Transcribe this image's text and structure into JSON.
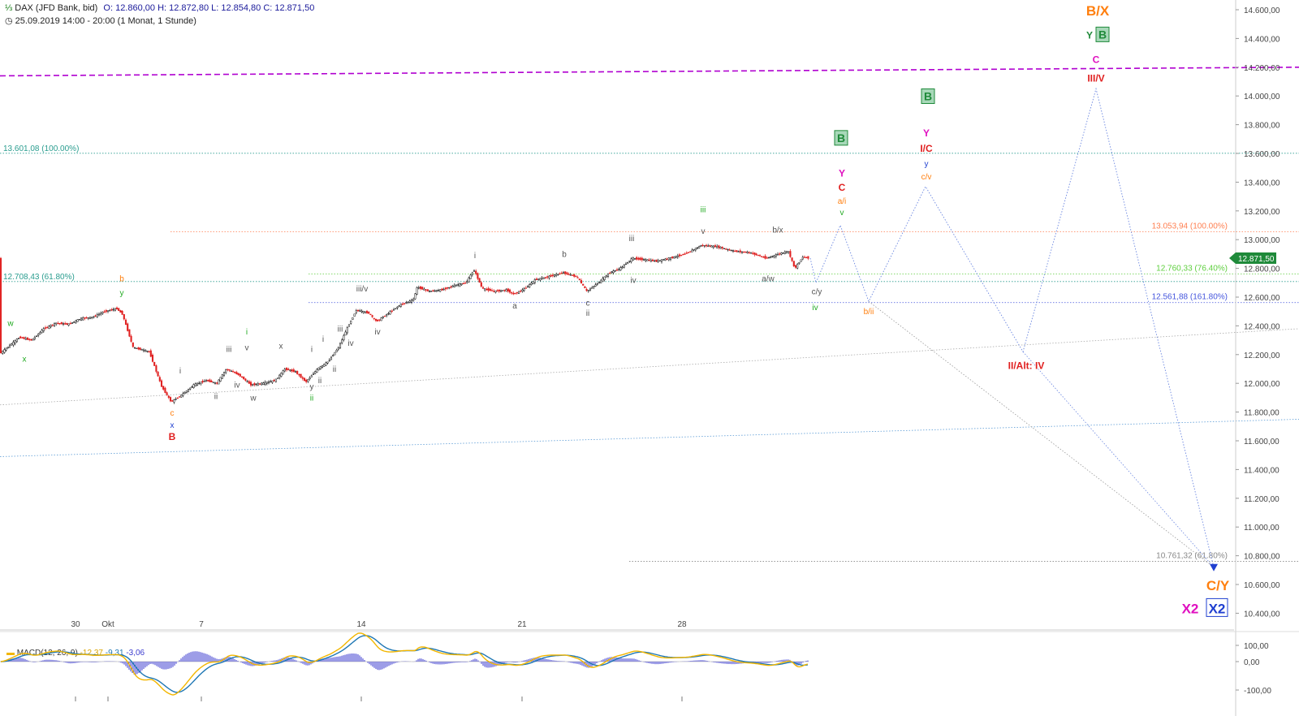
{
  "header": {
    "instrument": "DAX (JFD Bank, bid)",
    "ohlc": "O: 12.860,00  H: 12.872,80  L: 12.854,80  C: 12.871,50",
    "period": "25.09.2019 14:00 - 20:00   (1 Monat, 1 Stunde)"
  },
  "macd": {
    "label": "MACD(12, 26, 9)",
    "v1": "-12,37",
    "v2": "-9,31",
    "v3": "-3,06",
    "axis_labels": [
      "100,00",
      "0,00",
      "-100,00"
    ]
  },
  "price_badge": "12.871,50",
  "colors": {
    "candle_up": "#111111",
    "candle_down": "#e02020",
    "macd_line": "#f2b600",
    "signal_line": "#1f77b4",
    "hist": "#3b3bcf",
    "projection": "#6a86e0",
    "dashed_resistance": "#b000d0",
    "badge": "#1f8a3a"
  },
  "chart_data": {
    "type": "line",
    "title": "",
    "ylabel": "",
    "y_axis_ticks": [
      "14.600,00",
      "14.400,00",
      "14.200,00",
      "14.000,00",
      "13.800,00",
      "13.600,00",
      "13.400,00",
      "13.200,00",
      "13.000,00",
      "12.800,00",
      "12.600,00",
      "12.400,00",
      "12.200,00",
      "12.000,00",
      "11.800,00",
      "11.600,00",
      "11.400,00",
      "11.200,00",
      "11.000,00",
      "10.800,00",
      "10.600,00",
      "10.400,00"
    ],
    "ylim": [
      10350,
      14650
    ],
    "x_axis_labels": [
      "30",
      "Okt",
      "7",
      "14",
      "21",
      "28"
    ],
    "price_path": [
      {
        "x": 0,
        "y": 12200
      },
      {
        "x": 10,
        "y": 12250
      },
      {
        "x": 25,
        "y": 12320
      },
      {
        "x": 40,
        "y": 12300
      },
      {
        "x": 55,
        "y": 12380
      },
      {
        "x": 70,
        "y": 12420
      },
      {
        "x": 85,
        "y": 12410
      },
      {
        "x": 100,
        "y": 12450
      },
      {
        "x": 115,
        "y": 12460
      },
      {
        "x": 130,
        "y": 12500
      },
      {
        "x": 145,
        "y": 12520
      },
      {
        "x": 152,
        "y": 12480
      },
      {
        "x": 165,
        "y": 12250
      },
      {
        "x": 185,
        "y": 12220
      },
      {
        "x": 200,
        "y": 11980
      },
      {
        "x": 212,
        "y": 11870
      },
      {
        "x": 225,
        "y": 11920
      },
      {
        "x": 240,
        "y": 11990
      },
      {
        "x": 255,
        "y": 12020
      },
      {
        "x": 268,
        "y": 12000
      },
      {
        "x": 280,
        "y": 12100
      },
      {
        "x": 295,
        "y": 12060
      },
      {
        "x": 310,
        "y": 11990
      },
      {
        "x": 325,
        "y": 12000
      },
      {
        "x": 340,
        "y": 12020
      },
      {
        "x": 352,
        "y": 12100
      },
      {
        "x": 365,
        "y": 12080
      },
      {
        "x": 378,
        "y": 12010
      },
      {
        "x": 392,
        "y": 12100
      },
      {
        "x": 405,
        "y": 12150
      },
      {
        "x": 418,
        "y": 12250
      },
      {
        "x": 430,
        "y": 12400
      },
      {
        "x": 440,
        "y": 12510
      },
      {
        "x": 455,
        "y": 12490
      },
      {
        "x": 465,
        "y": 12430
      },
      {
        "x": 480,
        "y": 12490
      },
      {
        "x": 495,
        "y": 12550
      },
      {
        "x": 510,
        "y": 12580
      },
      {
        "x": 515,
        "y": 12670
      },
      {
        "x": 530,
        "y": 12640
      },
      {
        "x": 545,
        "y": 12650
      },
      {
        "x": 560,
        "y": 12680
      },
      {
        "x": 575,
        "y": 12700
      },
      {
        "x": 585,
        "y": 12790
      },
      {
        "x": 595,
        "y": 12660
      },
      {
        "x": 610,
        "y": 12640
      },
      {
        "x": 625,
        "y": 12650
      },
      {
        "x": 634,
        "y": 12620
      },
      {
        "x": 648,
        "y": 12660
      },
      {
        "x": 660,
        "y": 12720
      },
      {
        "x": 675,
        "y": 12740
      },
      {
        "x": 695,
        "y": 12770
      },
      {
        "x": 712,
        "y": 12740
      },
      {
        "x": 724,
        "y": 12640
      },
      {
        "x": 738,
        "y": 12700
      },
      {
        "x": 752,
        "y": 12770
      },
      {
        "x": 765,
        "y": 12800
      },
      {
        "x": 780,
        "y": 12870
      },
      {
        "x": 795,
        "y": 12860
      },
      {
        "x": 810,
        "y": 12850
      },
      {
        "x": 825,
        "y": 12870
      },
      {
        "x": 845,
        "y": 12900
      },
      {
        "x": 865,
        "y": 12960
      },
      {
        "x": 885,
        "y": 12950
      },
      {
        "x": 905,
        "y": 12920
      },
      {
        "x": 925,
        "y": 12910
      },
      {
        "x": 945,
        "y": 12870
      },
      {
        "x": 960,
        "y": 12900
      },
      {
        "x": 972,
        "y": 12920
      },
      {
        "x": 980,
        "y": 12800
      },
      {
        "x": 990,
        "y": 12880
      },
      {
        "x": 998,
        "y": 12871
      }
    ],
    "projection_paths": [
      [
        {
          "x": 998,
          "y": 12871
        },
        {
          "x": 1005,
          "y": 12700
        },
        {
          "x": 1035,
          "y": 13100
        },
        {
          "x": 1070,
          "y": 12570
        },
        {
          "x": 1140,
          "y": 13370
        },
        {
          "x": 1260,
          "y": 12220
        },
        {
          "x": 1350,
          "y": 14050
        },
        {
          "x": 1495,
          "y": 10720
        }
      ]
    ],
    "fib_levels": [
      {
        "value": 13601.08,
        "label": "13.601,08 (100.00%)"
      },
      {
        "value": 12708.43,
        "label": "12.708,43 (61.80%)"
      },
      {
        "value": 13053.94,
        "label": "13.053,94 (100.00%)"
      },
      {
        "value": 12760.33,
        "label": "12.760,33 (76.40%)"
      },
      {
        "value": 12561.88,
        "label": "12.561,88 (161.80%)"
      },
      {
        "value": 10761.32,
        "label": "10.761,32 (61.80%)"
      }
    ],
    "wave_labels": [
      {
        "text": "w",
        "x": 13,
        "y": 12400,
        "color": "#22aa22"
      },
      {
        "text": "x",
        "x": 30,
        "y": 12150,
        "color": "#22aa22"
      },
      {
        "text": "b",
        "x": 150,
        "y": 12710,
        "color": "#ff7f0e"
      },
      {
        "text": "y",
        "x": 150,
        "y": 12610,
        "color": "#22aa22"
      },
      {
        "text": "c",
        "x": 212,
        "y": 11775,
        "color": "#ff7f0e"
      },
      {
        "text": "x",
        "x": 212,
        "y": 11690,
        "color": "#1f3fd0"
      },
      {
        "text": "B",
        "x": 212,
        "y": 11605,
        "color": "#e02020"
      },
      {
        "text": "i",
        "x": 222,
        "y": 12070,
        "color": "#555555"
      },
      {
        "text": "ii",
        "x": 266,
        "y": 11890,
        "color": "#555555"
      },
      {
        "text": "iii",
        "x": 282,
        "y": 12220,
        "color": "#555555"
      },
      {
        "text": "iv",
        "x": 292,
        "y": 11970,
        "color": "#555555"
      },
      {
        "text": "v",
        "x": 304,
        "y": 12230,
        "color": "#555555"
      },
      {
        "text": "i",
        "x": 304,
        "y": 12340,
        "color": "#22aa22"
      },
      {
        "text": "w",
        "x": 312,
        "y": 11880,
        "color": "#555555"
      },
      {
        "text": "x",
        "x": 346,
        "y": 12240,
        "color": "#555555"
      },
      {
        "text": "i",
        "x": 384,
        "y": 12220,
        "color": "#555555"
      },
      {
        "text": "y",
        "x": 384,
        "y": 11960,
        "color": "#555555"
      },
      {
        "text": "ii",
        "x": 384,
        "y": 11880,
        "color": "#22aa22"
      },
      {
        "text": "ii",
        "x": 394,
        "y": 12000,
        "color": "#555555"
      },
      {
        "text": "i",
        "x": 398,
        "y": 12290,
        "color": "#555555"
      },
      {
        "text": "ii",
        "x": 412,
        "y": 12080,
        "color": "#555555"
      },
      {
        "text": "iii",
        "x": 419,
        "y": 12360,
        "color": "#555555"
      },
      {
        "text": "iv",
        "x": 432,
        "y": 12260,
        "color": "#555555"
      },
      {
        "text": "iii/v",
        "x": 446,
        "y": 12640,
        "color": "#555555"
      },
      {
        "text": "iv",
        "x": 465,
        "y": 12340,
        "color": "#555555"
      },
      {
        "text": "i",
        "x": 585,
        "y": 12870,
        "color": "#555555"
      },
      {
        "text": "b",
        "x": 695,
        "y": 12880,
        "color": "#555555"
      },
      {
        "text": "a",
        "x": 634,
        "y": 12520,
        "color": "#555555"
      },
      {
        "text": "c",
        "x": 724,
        "y": 12540,
        "color": "#555555"
      },
      {
        "text": "ii",
        "x": 724,
        "y": 12470,
        "color": "#555555"
      },
      {
        "text": "iii",
        "x": 778,
        "y": 12990,
        "color": "#555555"
      },
      {
        "text": "iv",
        "x": 780,
        "y": 12700,
        "color": "#555555"
      },
      {
        "text": "iii",
        "x": 866,
        "y": 13190,
        "color": "#22aa22"
      },
      {
        "text": "v",
        "x": 866,
        "y": 13040,
        "color": "#555555"
      },
      {
        "text": "b/x",
        "x": 958,
        "y": 13050,
        "color": "#555555"
      },
      {
        "text": "a/w",
        "x": 946,
        "y": 12710,
        "color": "#555555"
      },
      {
        "text": "c/y",
        "x": 1006,
        "y": 12620,
        "color": "#555555"
      },
      {
        "text": "iv",
        "x": 1004,
        "y": 12510,
        "color": "#22aa22"
      },
      {
        "text": "v",
        "x": 1037,
        "y": 13170,
        "color": "#22aa22"
      },
      {
        "text": "a/i",
        "x": 1037,
        "y": 13250,
        "color": "#ff7f0e"
      },
      {
        "text": "C",
        "x": 1037,
        "y": 13340,
        "color": "#e02020"
      },
      {
        "text": "Y",
        "x": 1037,
        "y": 13440,
        "color": "#e010c0"
      },
      {
        "text": "b/ii",
        "x": 1070,
        "y": 12480,
        "color": "#ff7f0e"
      },
      {
        "text": "c/v",
        "x": 1141,
        "y": 13420,
        "color": "#ff7f0e"
      },
      {
        "text": "y",
        "x": 1141,
        "y": 13510,
        "color": "#1f3fd0"
      },
      {
        "text": "I/C",
        "x": 1141,
        "y": 13610,
        "color": "#e02020"
      },
      {
        "text": "Y",
        "x": 1141,
        "y": 13720,
        "color": "#e010c0"
      },
      {
        "text": "II/Alt: IV",
        "x": 1264,
        "y": 12100,
        "color": "#e02020"
      },
      {
        "text": "III/V",
        "x": 1350,
        "y": 14100,
        "color": "#e02020"
      },
      {
        "text": "C",
        "x": 1350,
        "y": 14230,
        "color": "#e010c0"
      },
      {
        "text": "Y",
        "x": 1342,
        "y": 14400,
        "color": "#1f8a3a"
      },
      {
        "text": "B/X",
        "x": 1352,
        "y": 14560,
        "color": "#ff7f0e"
      },
      {
        "text": "C/Y",
        "x": 1500,
        "y": 10560,
        "color": "#ff7f0e"
      },
      {
        "text": "X2",
        "x": 1466,
        "y": 10400,
        "color": "#e010c0"
      }
    ],
    "boxed_labels": [
      {
        "text": "B",
        "x": 1036,
        "y": 13680,
        "color": "#1f8a3a"
      },
      {
        "text": "B",
        "x": 1143,
        "y": 13970,
        "color": "#1f8a3a"
      },
      {
        "text": "B",
        "x": 1358,
        "y": 14400,
        "color": "#1f8a3a"
      },
      {
        "text": "X2",
        "x": 1499,
        "y": 10400,
        "color": "#1f3fd0"
      }
    ]
  }
}
